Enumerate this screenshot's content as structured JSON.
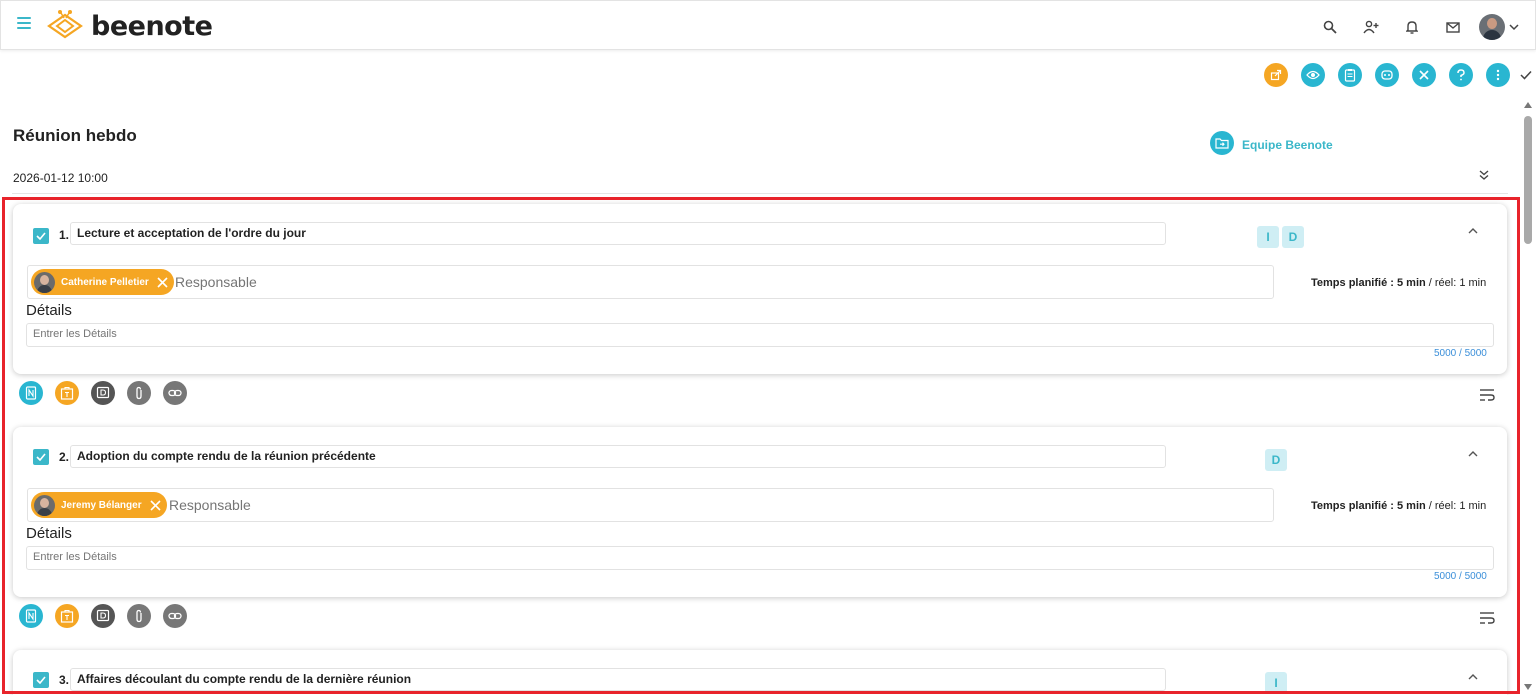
{
  "header": {
    "brand": "beenote",
    "icons": [
      "menu-icon",
      "search-icon",
      "add-user-icon",
      "bell-icon",
      "mail-icon",
      "avatar",
      "chevron-down-icon"
    ]
  },
  "toolbar": {
    "icons": [
      "share-icon",
      "eye-icon",
      "clipboard-icon",
      "robot-icon",
      "close-icon",
      "help-icon",
      "more-icon",
      "check-icon"
    ]
  },
  "meeting": {
    "title": "Réunion hebdo",
    "date": "2026-01-12 10:00",
    "team": "Equipe Beenote"
  },
  "items": [
    {
      "number": "1.",
      "title": "Lecture et acceptation de l'ordre du jour",
      "tags": [
        "I",
        "D"
      ],
      "responsible": "Catherine Pelletier",
      "responsible_placeholder": "Responsable",
      "time_label": "Temps planifié :",
      "time_planned": "5 min",
      "time_real": "/ réel: 1 min",
      "details_label": "Détails",
      "details_placeholder": "Entrer les Détails",
      "counter": "5000 / 5000"
    },
    {
      "number": "2.",
      "title": "Adoption du compte rendu de la réunion précédente",
      "tags": [
        "D"
      ],
      "responsible": "Jeremy Bélanger",
      "responsible_placeholder": "Responsable",
      "time_label": "Temps planifié :",
      "time_planned": "5 min",
      "time_real": "/ réel: 1 min",
      "details_label": "Détails",
      "details_placeholder": "Entrer les Détails",
      "counter": "5000 / 5000"
    },
    {
      "number": "3.",
      "title": "Affaires découlant du compte rendu de la dernière réunion",
      "tags": [
        "I"
      ]
    }
  ],
  "item_actions": [
    "note-icon",
    "task-icon",
    "decision-icon",
    "attachment-icon",
    "link-icon"
  ],
  "colors": {
    "teal": "#29b6d1",
    "orange": "#f5a623",
    "highlight": "#e8232b"
  }
}
